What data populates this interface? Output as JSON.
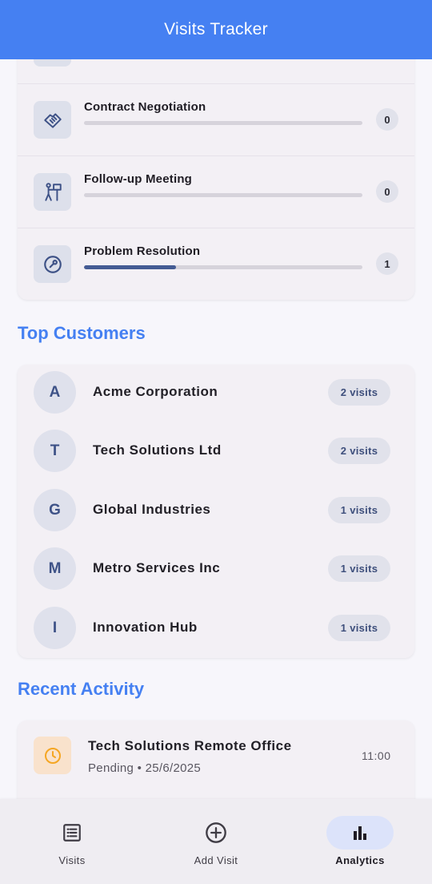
{
  "appbar": {
    "title": "Visits Tracker"
  },
  "visit_types": [
    {
      "label": "",
      "count": "",
      "progress": 0,
      "icon": "category-icon"
    },
    {
      "label": "Contract Negotiation",
      "count": "0",
      "progress": 0,
      "icon": "handshake-icon"
    },
    {
      "label": "Follow-up Meeting",
      "count": "0",
      "progress": 0,
      "icon": "presenter-icon"
    },
    {
      "label": "Problem Resolution",
      "count": "1",
      "progress": 0.33,
      "icon": "wrench-icon"
    }
  ],
  "top_customers": {
    "title": "Top Customers",
    "items": [
      {
        "initial": "A",
        "name": "Acme Corporation",
        "visits": "2 visits"
      },
      {
        "initial": "T",
        "name": "Tech Solutions Ltd",
        "visits": "2 visits"
      },
      {
        "initial": "G",
        "name": "Global Industries",
        "visits": "1 visits"
      },
      {
        "initial": "M",
        "name": "Metro Services Inc",
        "visits": "1 visits"
      },
      {
        "initial": "I",
        "name": "Innovation Hub",
        "visits": "1 visits"
      }
    ]
  },
  "recent_activity": {
    "title": "Recent Activity",
    "items": [
      {
        "title": "Tech Solutions Remote Office",
        "subtitle": "Pending • 25/6/2025",
        "time": "11:00",
        "icon": "clock-icon",
        "accent": "#f5a623"
      }
    ]
  },
  "bottom_nav": [
    {
      "label": "Visits",
      "icon": "list-icon",
      "active": false
    },
    {
      "label": "Add Visit",
      "icon": "add-circle-icon",
      "active": false
    },
    {
      "label": "Analytics",
      "icon": "bar-chart-icon",
      "active": true
    }
  ],
  "colors": {
    "primary": "#4580f2",
    "progress": "#445b94",
    "pending": "#f5a623"
  }
}
